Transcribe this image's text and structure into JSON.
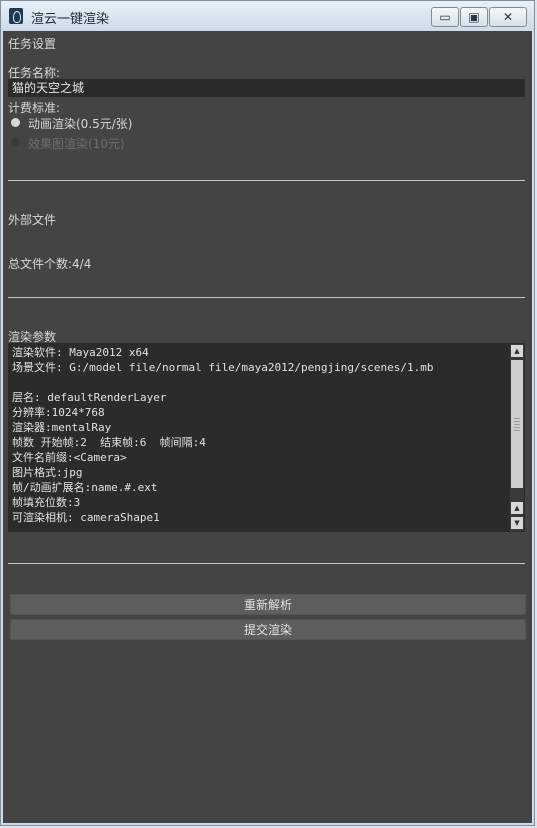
{
  "window": {
    "title": "渲云一键渲染",
    "controls": {
      "minimize": "▭",
      "maximize": "▣",
      "close": "✕"
    }
  },
  "task_settings": {
    "section_title": "任务设置",
    "task_name_label": "任务名称:",
    "task_name_value": "猫的天空之城",
    "billing_label": "计费标准:",
    "billing_options": [
      {
        "label": "动画渲染(0.5元/张)",
        "selected": true,
        "enabled": true
      },
      {
        "label": "效果图渲染(10元)",
        "selected": false,
        "enabled": false
      }
    ]
  },
  "external_files": {
    "section_title": "外部文件",
    "total_files": "总文件个数:4/4"
  },
  "render_params": {
    "section_title": "渲染参数",
    "lines": [
      "渲染软件: Maya2012 x64",
      "场景文件: G:/model file/normal file/maya2012/pengjing/scenes/1.mb",
      "",
      "层名: defaultRenderLayer",
      "分辨率:1024*768",
      "渲染器:mentalRay",
      "帧数 开始帧:2  结束帧:6  帧间隔:4",
      "文件名前缀:<Camera>",
      "图片格式:jpg",
      "帧/动画扩展名:name.#.ext",
      "帧填充位数:3",
      "可渲染相机: cameraShape1"
    ]
  },
  "actions": {
    "reparse": "重新解析",
    "submit": "提交渲染"
  },
  "colors": {
    "panel_bg": "#444444",
    "field_bg": "#2b2b2b",
    "button_bg": "#5d5d5d"
  }
}
